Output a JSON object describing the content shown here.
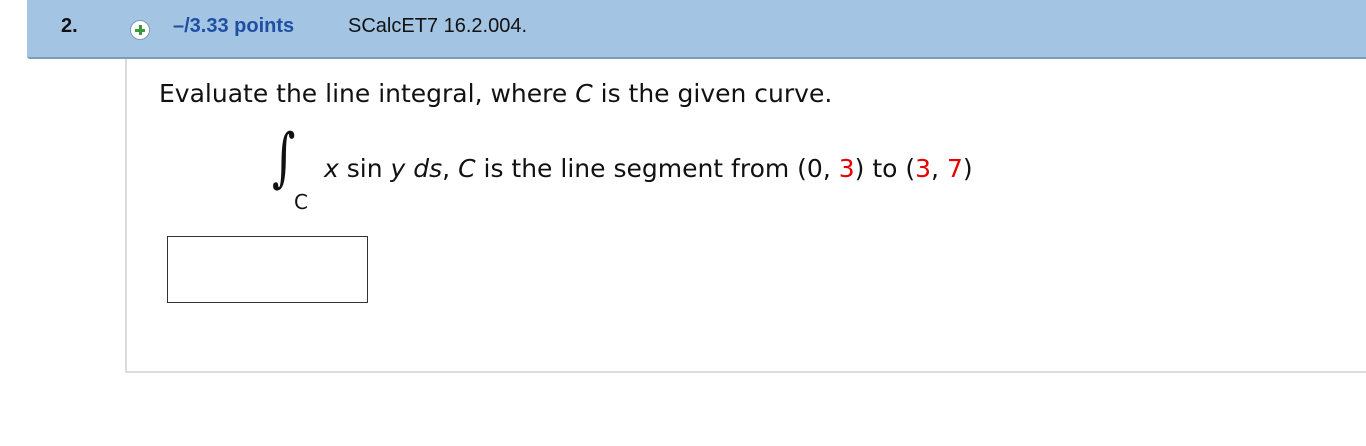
{
  "question": {
    "number": "2.",
    "points": "–/3.33 points",
    "source": "SCalcET7 16.2.004."
  },
  "prompt": {
    "before_var": "Evaluate the line integral, where ",
    "var": "C",
    "after_var": " is the given curve."
  },
  "integral": {
    "sign": "∫",
    "subscript": "C",
    "integrand_x": "x",
    "integrand_sin": " sin ",
    "integrand_y": "y",
    "integrand_space": " ",
    "integrand_ds": "ds",
    "comma": ", ",
    "curve_var": "C",
    "curve_text": "  is the line segment from (0, ",
    "y1": "3",
    "to_text": ") to (",
    "x2": "3",
    "sep": ", ",
    "y2": "7",
    "close": ")"
  },
  "answer": {
    "value": ""
  },
  "colors": {
    "header_bg": "#a3c5e3",
    "points_link": "#1f4fa3",
    "highlight_red": "#e60000",
    "plus_green": "#3b9a3b"
  },
  "icons": {
    "expand": "plus-icon"
  }
}
